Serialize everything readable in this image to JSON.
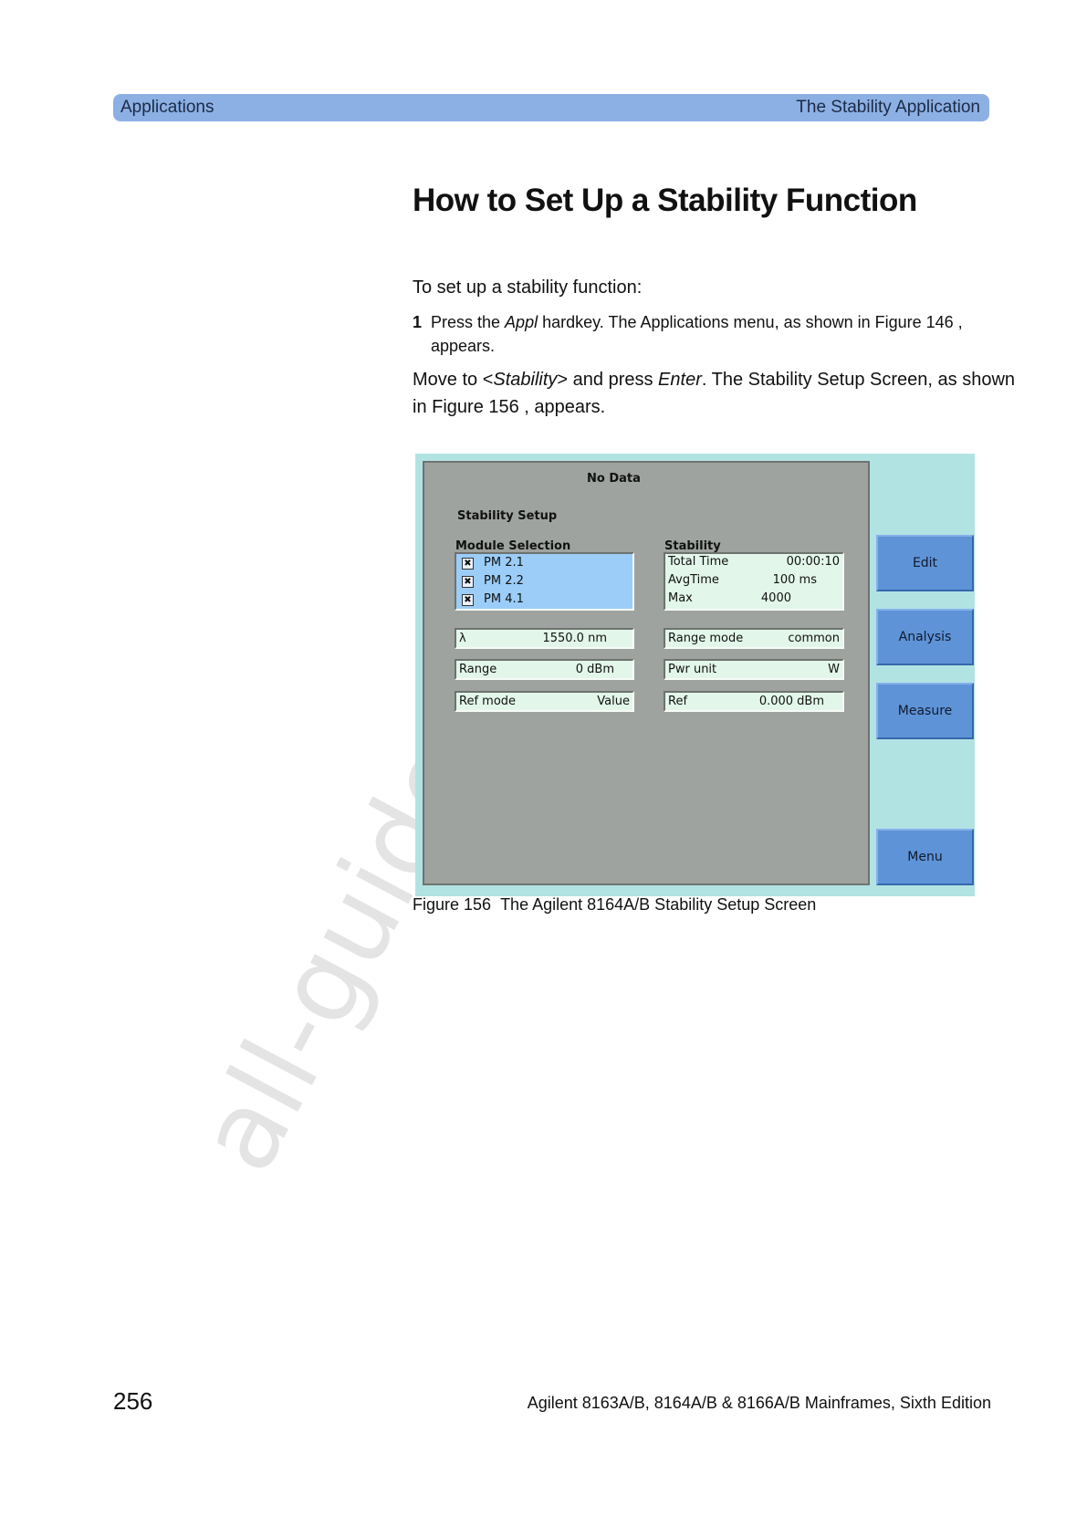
{
  "header": {
    "section": "Applications",
    "chapter": "The Stability Application"
  },
  "heading": "How to Set Up a Stability Function",
  "intro": "To set up a stability function:",
  "step1": {
    "number": "1",
    "press": "Press the ",
    "hardkey": "Appl",
    "line1_rest": " hardkey. The Applications menu, as shown in Figure 146  ,",
    "line2": "appears."
  },
  "move_para": {
    "move_to": "Move to <",
    "stability": "Stability",
    "and_press": "> and press ",
    "enter": "Enter",
    "rest1": ". The Stability Setup Screen, as shown",
    "line2": "in Figure 156  , appears."
  },
  "screen": {
    "status": "No Data",
    "title": "Stability Setup",
    "module_selection_label": "Module Selection",
    "modules": [
      {
        "checked": "✖",
        "label": "PM 2.1"
      },
      {
        "checked": "✖",
        "label": "PM 2.2"
      },
      {
        "checked": "✖",
        "label": "PM 4.1"
      }
    ],
    "stability_label": "Stability",
    "stability_rows": [
      {
        "key": "Total Time",
        "value": "00:00:10"
      },
      {
        "key": "AvgTime",
        "value": "100  ms"
      },
      {
        "key": "Max",
        "value": "4000"
      }
    ],
    "wavelength": {
      "key": "λ",
      "value": "1550.0  nm"
    },
    "range": {
      "key": "Range",
      "value": "0  dBm"
    },
    "ref_mode": {
      "key": "Ref mode",
      "value": "Value"
    },
    "range_mode": {
      "key": "Range mode",
      "value": "common"
    },
    "pwr_unit": {
      "key": "Pwr unit",
      "value": "W"
    },
    "ref": {
      "key": "Ref",
      "value": "0.000  dBm"
    },
    "softkeys": {
      "edit": "Edit",
      "analysis": "Analysis",
      "measure": "Measure",
      "menu": "Menu"
    }
  },
  "caption": {
    "label": "Figure 156",
    "title": "The Agilent 8164A/B Stability Setup Screen"
  },
  "watermark": "all-guides.com",
  "footer": {
    "page_number": "256",
    "doc_title": "Agilent 8163A/B, 8164A/B & 8166A/B Mainframes, Sixth Edition"
  }
}
